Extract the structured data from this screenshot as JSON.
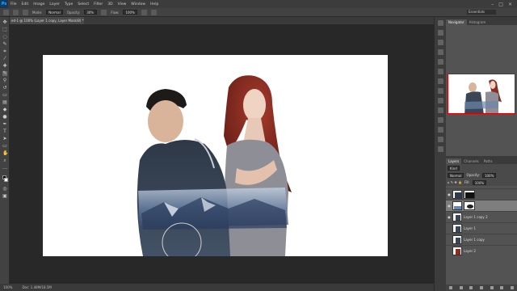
{
  "app": {
    "logo": "Ps"
  },
  "menu": [
    "File",
    "Edit",
    "Image",
    "Layer",
    "Type",
    "Select",
    "Filter",
    "3D",
    "View",
    "Window",
    "Help"
  ],
  "window_controls": [
    "–",
    "□",
    "×"
  ],
  "options": {
    "mode_label": "Mode:",
    "mode_value": "Normal",
    "opacity_label": "Opacity:",
    "opacity_value": "30%",
    "flow_label": "Flow:",
    "flow_value": "100%",
    "workspace": "Essentials"
  },
  "document": {
    "tab_title": "ed-1 @ 100% (Layer 1 copy, Layer Mask/8) *"
  },
  "status": {
    "zoom": "100%",
    "doc_info": "Doc: 1.48M/18.5M"
  },
  "navigator": {
    "tabs": [
      "Navigator",
      "Histogram"
    ],
    "zoom": "100%"
  },
  "layers_panel": {
    "tabs": [
      "Layers",
      "Channels",
      "Paths"
    ],
    "kind_label": "Kind",
    "blend_mode": "Normal",
    "opacity_label": "Opacity:",
    "opacity_value": "100%",
    "fill_label": "Fill:",
    "fill_value": "100%",
    "layers": [
      {
        "name": "",
        "visible": true,
        "active": false,
        "has_mask": true
      },
      {
        "name": "",
        "visible": true,
        "active": true,
        "has_mask": true
      },
      {
        "name": "Layer 1 copy 2",
        "visible": true,
        "active": false,
        "has_mask": false
      },
      {
        "name": "Layer 1",
        "visible": false,
        "active": false,
        "has_mask": false
      },
      {
        "name": "Layer 1 copy",
        "visible": false,
        "active": false,
        "has_mask": false
      },
      {
        "name": "Layer 2",
        "visible": false,
        "active": false,
        "has_mask": false
      }
    ]
  },
  "colors": {
    "accent": "#31a8ff",
    "workspace_bg": "#282828",
    "panel_bg": "#535353",
    "active_layer": "#7e7e7e"
  }
}
